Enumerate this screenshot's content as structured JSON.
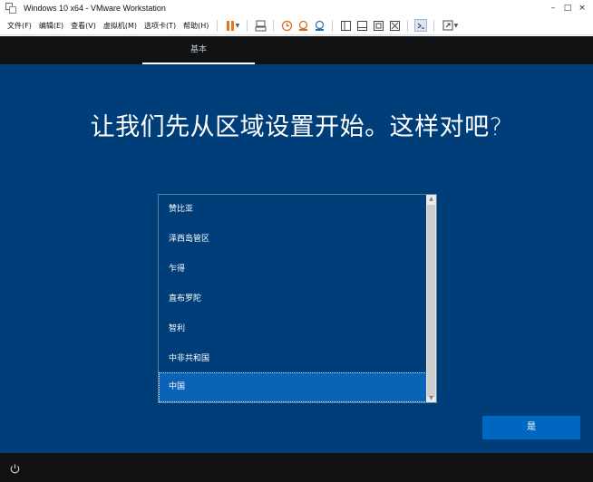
{
  "window": {
    "title": "Windows 10 x64 - VMware Workstation",
    "minimize": "–",
    "maximize": "□",
    "close": "×"
  },
  "menu": {
    "items": [
      "文件(F)",
      "编辑(E)",
      "查看(V)",
      "虚拟机(M)",
      "选项卡(T)",
      "帮助(H)"
    ]
  },
  "toolbar": {
    "icons": [
      "pause-icon",
      "send-ctrl-alt-del-icon",
      "snapshot-icon",
      "revert-snapshot-icon",
      "snapshot-manager-icon",
      "library-icon",
      "thumbnail-bar-icon",
      "fit-guest-icon",
      "unity-icon",
      "console-view-icon",
      "full-screen-icon"
    ],
    "accent": "#e87722"
  },
  "setup": {
    "tab": "基本",
    "heading": "让我们先从区域设置开始。这样对吧?",
    "regions": [
      "赞比亚",
      "泽西岛管区",
      "乍得",
      "直布罗陀",
      "智利",
      "中非共和国",
      "中国"
    ],
    "selected_region": "中国",
    "confirm_button": "是",
    "background_color": "#003e7a",
    "button_color": "#0067c0"
  },
  "taskbar": {
    "icon": "accessibility-icon"
  }
}
